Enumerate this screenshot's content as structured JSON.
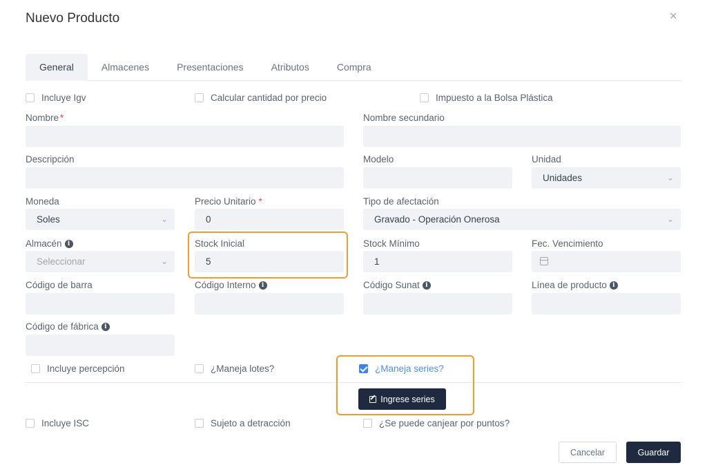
{
  "modal": {
    "title": "Nuevo Producto",
    "close_glyph": "×"
  },
  "tabs": [
    "General",
    "Almacenes",
    "Presentaciones",
    "Atributos",
    "Compra"
  ],
  "checks_top": {
    "incluye_igv": "Incluye Igv",
    "calcular_cantidad": "Calcular cantidad por precio",
    "impuesto_bolsa": "Impuesto a la Bolsa Plástica"
  },
  "fields": {
    "nombre": {
      "label": "Nombre",
      "required_mark": "*",
      "value": ""
    },
    "nombre_secundario": {
      "label": "Nombre secundario",
      "value": ""
    },
    "descripcion": {
      "label": "Descripción",
      "value": ""
    },
    "modelo": {
      "label": "Modelo",
      "value": ""
    },
    "unidad": {
      "label": "Unidad",
      "value": "Unidades"
    },
    "moneda": {
      "label": "Moneda",
      "value": "Soles"
    },
    "precio_unitario": {
      "label": "Precio Unitario",
      "required_mark": "*",
      "value": "0"
    },
    "tipo_afectacion": {
      "label": "Tipo de afectación",
      "value": "Gravado - Operación Onerosa"
    },
    "almacen": {
      "label": "Almacén",
      "placeholder": "Seleccionar"
    },
    "stock_inicial": {
      "label": "Stock Inicial",
      "value": "5"
    },
    "stock_minimo": {
      "label": "Stock Mínimo",
      "value": "1"
    },
    "fec_vencimiento": {
      "label": "Fec. Vencimiento",
      "value": ""
    },
    "codigo_barra": {
      "label": "Código de barra",
      "value": ""
    },
    "codigo_interno": {
      "label": "Código Interno",
      "value": ""
    },
    "codigo_sunat": {
      "label": "Código Sunat",
      "value": ""
    },
    "linea_producto": {
      "label": "Línea de producto",
      "value": ""
    },
    "codigo_fabrica": {
      "label": "Código de fábrica",
      "value": ""
    }
  },
  "checks_mid": {
    "incluye_percepcion": "Incluye percepción",
    "maneja_lotes": "¿Maneja lotes?",
    "maneja_series": "¿Maneja series?",
    "maneja_series_checked": true
  },
  "series_button": "Ingrese series",
  "checks_bottom": {
    "incluye_isc": "Incluye ISC",
    "sujeto_detraccion": "Sujeto a detracción",
    "canjear_puntos": "¿Se puede canjear por puntos?"
  },
  "footer": {
    "cancel": "Cancelar",
    "save": "Guardar"
  },
  "icon_names": {
    "info": "info-icon",
    "chevron": "chevron-down-icon",
    "calendar": "calendar-icon",
    "edit": "edit-icon",
    "close": "close-icon"
  }
}
